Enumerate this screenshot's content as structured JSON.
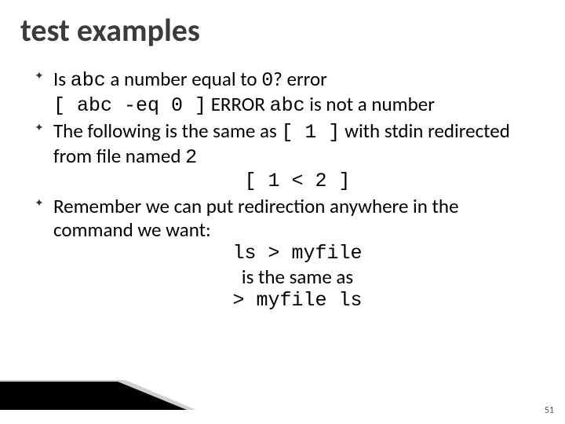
{
  "title": "test examples",
  "bullets": [
    {
      "prefix": "Is ",
      "code1": "abc",
      "mid1": " a number equal to ",
      "code2": "0",
      "mid2": "? error",
      "line2_code": "[ abc -eq 0 ]",
      "line2_err_pre": "  ERROR ",
      "line2_err_code": "abc",
      "line2_err_post": " is not a number"
    },
    {
      "prefix": "The following is the same as ",
      "code1": "[ 1 ]",
      "mid1": " with stdin redirected from file named ",
      "code2": "2",
      "center_code": "[ 1 < 2 ]"
    },
    {
      "prefix": "Remember we can put redirection anywhere in the command we want:",
      "center1_code": "ls > myfile",
      "center2_text": "is the same as",
      "center3_code": "> myfile ls"
    }
  ],
  "page_number": "51"
}
